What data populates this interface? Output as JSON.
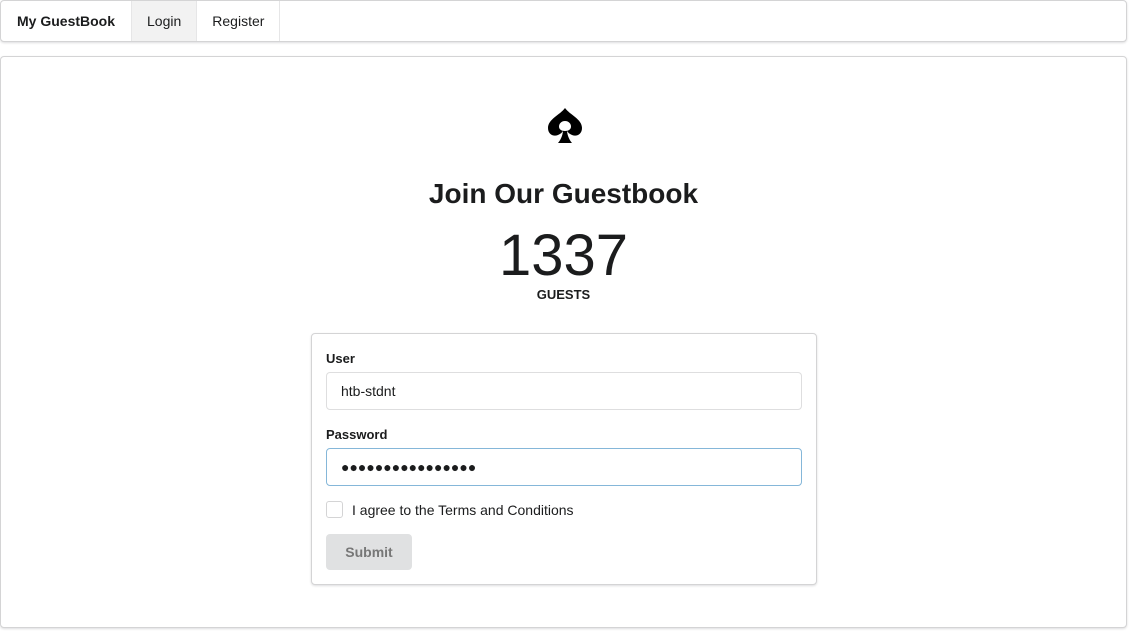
{
  "nav": {
    "brand": "My GuestBook",
    "items": [
      {
        "label": "Login",
        "active": true
      },
      {
        "label": "Register",
        "active": false
      }
    ]
  },
  "main": {
    "logo_icon": "spade-icon",
    "title": "Join Our Guestbook",
    "stat": {
      "value": "1337",
      "label": "GUESTS"
    }
  },
  "form": {
    "user_label": "User",
    "user_value": "htb-stdnt",
    "password_label": "Password",
    "password_value": "●●●●●●●●●●●●●●●●",
    "terms_label": "I agree to the Terms and Conditions",
    "terms_checked": false,
    "submit_label": "Submit"
  },
  "colors": {
    "active_tab": "#f2f2f2",
    "focus_border": "#85b7d9",
    "button_bg": "#e0e1e2"
  }
}
